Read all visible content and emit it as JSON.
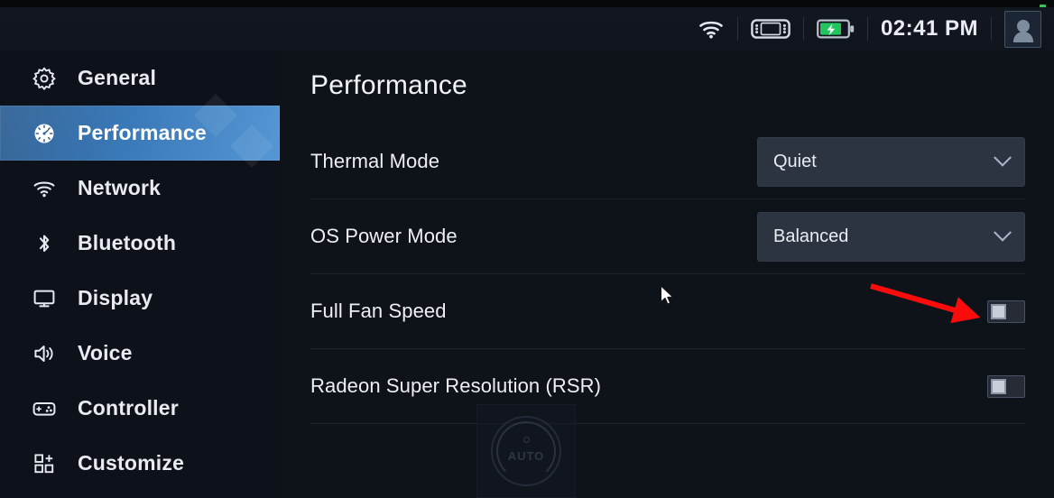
{
  "statusbar": {
    "icons": [
      "wifi-icon",
      "handheld-device-icon",
      "battery-charging-icon"
    ],
    "time": "02:41 PM",
    "avatar_name": "user-avatar",
    "indicator_color": "#3fbf5c"
  },
  "sidebar": {
    "items": [
      {
        "label": "General",
        "icon": "gear-icon",
        "active": false
      },
      {
        "label": "Performance",
        "icon": "gauge-icon",
        "active": true
      },
      {
        "label": "Network",
        "icon": "wifi-icon",
        "active": false
      },
      {
        "label": "Bluetooth",
        "icon": "bluetooth-icon",
        "active": false
      },
      {
        "label": "Display",
        "icon": "monitor-icon",
        "active": false
      },
      {
        "label": "Voice",
        "icon": "speaker-icon",
        "active": false
      },
      {
        "label": "Controller",
        "icon": "gamepad-icon",
        "active": false
      },
      {
        "label": "Customize",
        "icon": "grid-plus-icon",
        "active": false
      }
    ],
    "active_accent": "#3a79b8"
  },
  "main": {
    "title": "Performance",
    "rows": [
      {
        "label": "Thermal Mode",
        "control": "dropdown",
        "value": "Quiet"
      },
      {
        "label": "OS Power Mode",
        "control": "dropdown",
        "value": "Balanced"
      },
      {
        "label": "Full Fan Speed",
        "control": "toggle",
        "value": "off"
      },
      {
        "label": "Radeon Super Resolution (RSR)",
        "control": "toggle",
        "value": "off"
      }
    ]
  },
  "overlay": {
    "dial_label": "AUTO"
  },
  "annotation": {
    "type": "arrow",
    "color": "#fb0c0c",
    "points_to": "Full Fan Speed toggle"
  }
}
